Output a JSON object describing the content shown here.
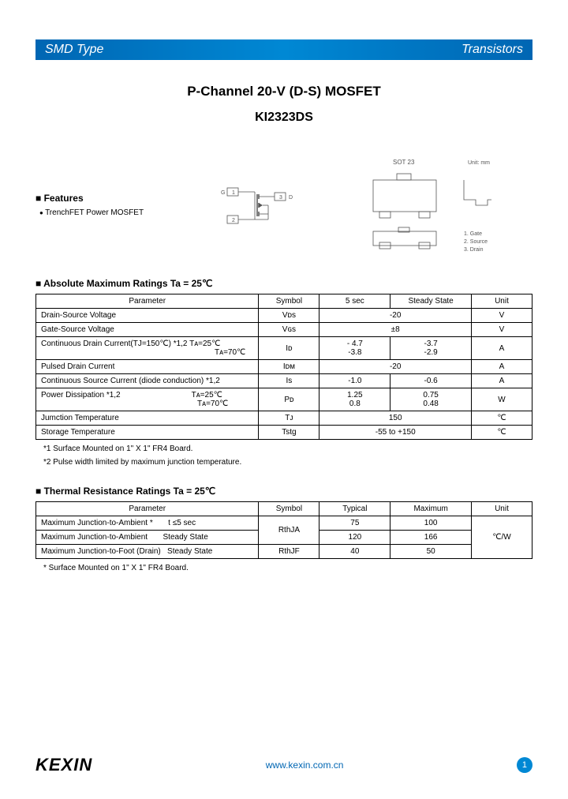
{
  "header": {
    "left": "SMD Type",
    "right": "Transistors"
  },
  "title": {
    "main": "P-Channel 20-V (D-S) MOSFET",
    "part": "KI2323DS"
  },
  "features": {
    "heading": "Features",
    "item1": "TrenchFET Power MOSFET"
  },
  "diagrams": {
    "pkg_label": "SOT 23",
    "unit_label": "Unit: mm",
    "pins": {
      "1": "1. Gate",
      "2": "2. Source",
      "3": "3. Drain"
    },
    "schem": {
      "g": "G",
      "d": "D",
      "p1": "1",
      "p2": "2",
      "p3": "3"
    }
  },
  "amr": {
    "heading": "Absolute Maximum Ratings Ta = 25℃",
    "headers": {
      "param": "Parameter",
      "sym": "Symbol",
      "c5": "5 sec",
      "ss": "Steady State",
      "unit": "Unit"
    },
    "rows": {
      "vds": {
        "p": "Drain-Source Voltage",
        "s": "Vᴅs",
        "v": "-20",
        "u": "V"
      },
      "vgs": {
        "p": "Gate-Source Voltage",
        "s": "Vɢs",
        "v": "±8",
        "u": "V"
      },
      "id": {
        "p": "Continuous Drain Current(TJ=150℃) *1,2 Tᴀ=25℃",
        "p2": "Tᴀ=70℃",
        "s": "Iᴅ",
        "c5": "- 4.7\n-3.8",
        "ss": "-3.7\n-2.9",
        "u": "A"
      },
      "idm": {
        "p": "Pulsed Drain Current",
        "s": "Iᴅᴍ",
        "v": "-20",
        "u": "A"
      },
      "is": {
        "p": "Continuous Source Current (diode conduction) *1,2",
        "s": "Is",
        "c5": "-1.0",
        "ss": "-0.6",
        "u": "A"
      },
      "pd": {
        "p": "Power Dissipation *1,2",
        "p2a": "Tᴀ=25℃",
        "p2b": "Tᴀ=70℃",
        "s": "Pᴅ",
        "c5": "1.25\n0.8",
        "ss": "0.75\n0.48",
        "u": "W"
      },
      "tj": {
        "p": "Jumction Temperature",
        "s": "Tᴊ",
        "v": "150",
        "u": "℃"
      },
      "tstg": {
        "p": "Storage Temperature",
        "s": "Tstg",
        "v": "-55 to +150",
        "u": "℃"
      }
    },
    "foot1": "*1 Surface Mounted on 1\" X 1\" FR4 Board.",
    "foot2": "*2 Pulse width limited by maximum junction temperature."
  },
  "thermal": {
    "heading": "Thermal Resistance Ratings Ta = 25℃",
    "headers": {
      "param": "Parameter",
      "sym": "Symbol",
      "typ": "Typical",
      "max": "Maximum",
      "unit": "Unit"
    },
    "rows": {
      "r1": {
        "p": "Maximum Junction-to-Ambient *       t ≤5 sec",
        "s": "RthJA",
        "t": "75",
        "m": "100"
      },
      "r2": {
        "p": "Maximum Junction-to-Ambient       Steady State",
        "t": "120",
        "m": "166"
      },
      "r3": {
        "p": "Maximum Junction-to-Foot (Drain)   Steady State",
        "s": "RthJF",
        "t": "40",
        "m": "50"
      },
      "unit": "℃/W"
    },
    "foot": "* Surface Mounted on 1\" X 1\" FR4 Board."
  },
  "footer": {
    "brand": "KEXIN",
    "url": "www.kexin.com.cn",
    "page": "1"
  }
}
